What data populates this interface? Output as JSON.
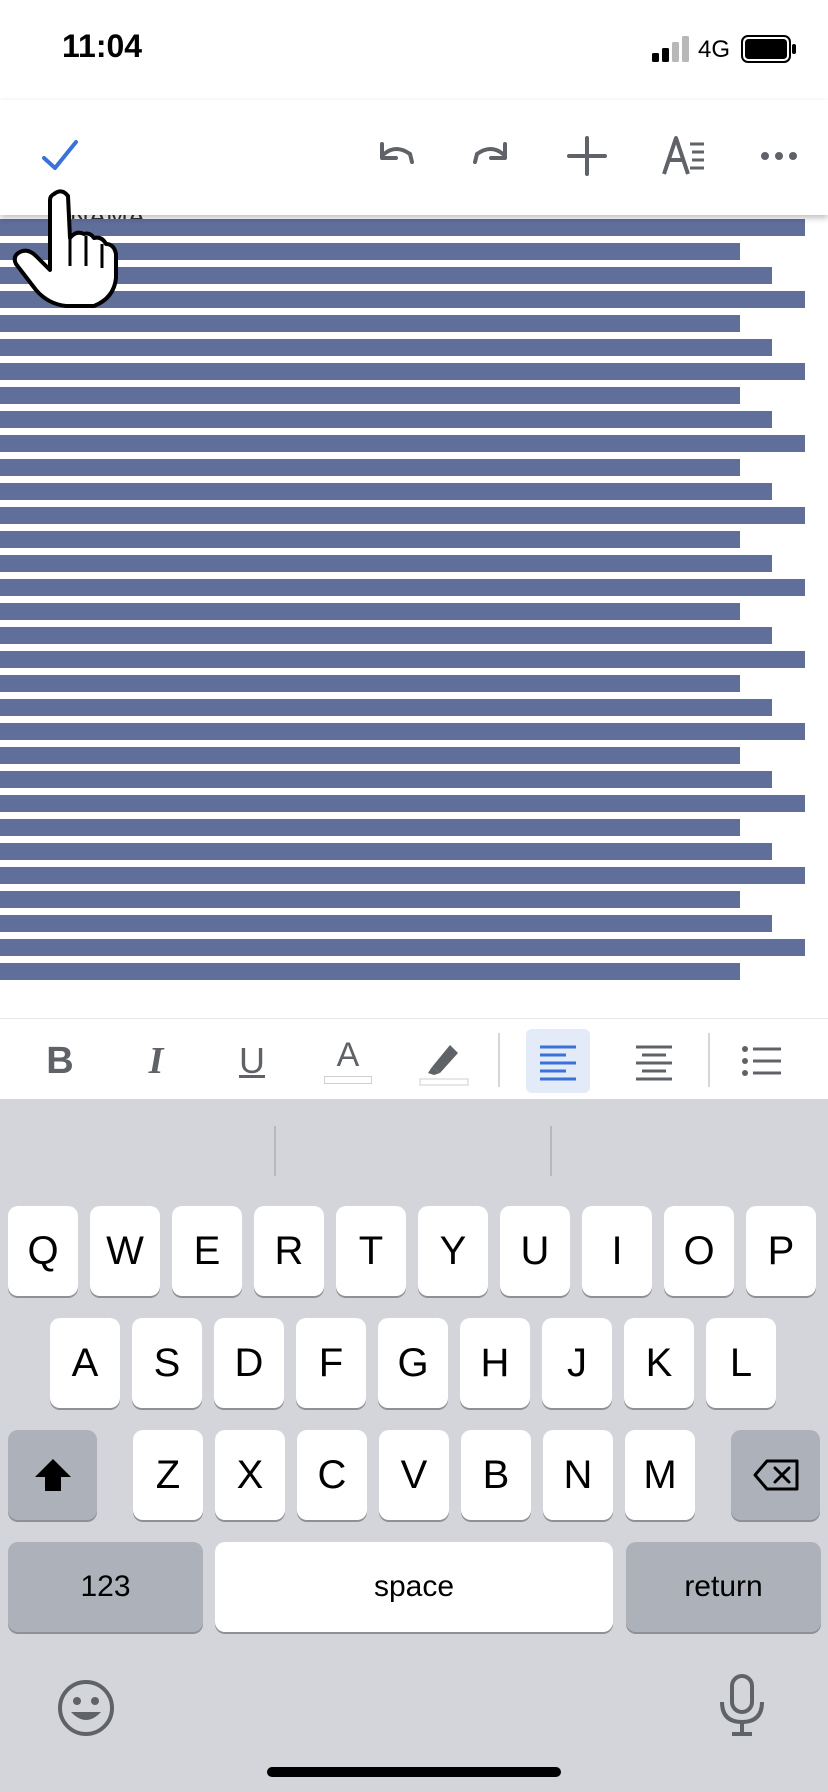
{
  "status_bar": {
    "time": "11:04",
    "network": "4G"
  },
  "toolbar": {
    "done_icon": "checkmark-icon",
    "undo_icon": "undo-icon",
    "redo_icon": "redo-icon",
    "insert_icon": "plus-icon",
    "format_icon": "text-format-icon",
    "more_icon": "more-horizontal-icon"
  },
  "document": {
    "heading_fragment": "NAMA"
  },
  "format_bar": {
    "bold_label": "B",
    "italic_label": "I",
    "underline_label": "U",
    "text_color_label": "A",
    "highlight_icon": "marker-icon",
    "align_left_icon": "align-left-icon",
    "align_center_icon": "align-center-icon",
    "list_icon": "bulleted-list-icon",
    "active_alignment": "left"
  },
  "keyboard": {
    "row1": [
      "Q",
      "W",
      "E",
      "R",
      "T",
      "Y",
      "U",
      "I",
      "O",
      "P"
    ],
    "row2": [
      "A",
      "S",
      "D",
      "F",
      "G",
      "H",
      "J",
      "K",
      "L"
    ],
    "row3": [
      "Z",
      "X",
      "C",
      "V",
      "B",
      "N",
      "M"
    ],
    "numbers_label": "123",
    "space_label": "space",
    "return_label": "return",
    "shift_icon": "shift-icon",
    "delete_icon": "backspace-icon",
    "emoji_icon": "emoji-icon",
    "mic_icon": "microphone-icon"
  },
  "colors": {
    "accent": "#3b72d9",
    "highlight": "#5f6f9a",
    "keyboard_bg": "#d3d5db"
  }
}
